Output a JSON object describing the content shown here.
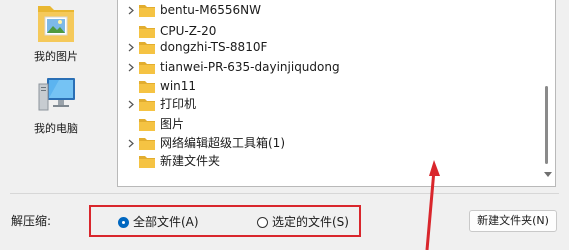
{
  "places": {
    "pictures_label": "我的图片",
    "pc_label": "我的电脑"
  },
  "tree": {
    "items": [
      {
        "name": "bentu-M6556NW",
        "expandable": true
      },
      {
        "name": "CPU-Z-20",
        "expandable": false
      },
      {
        "name": "dongzhi-TS-8810F",
        "expandable": true
      },
      {
        "name": "tianwei-PR-635-dayinjiqudong",
        "expandable": true
      },
      {
        "name": "win11",
        "expandable": false
      },
      {
        "name": "打印机",
        "expandable": true
      },
      {
        "name": "图片",
        "expandable": false
      },
      {
        "name": "网络编辑超级工具箱(1)",
        "expandable": true
      },
      {
        "name": "新建文件夹",
        "expandable": false
      }
    ]
  },
  "extract": {
    "label": "解压缩:",
    "option_all": "全部文件(A)",
    "option_selected": "选定的文件(S)",
    "selected": "all"
  },
  "buttons": {
    "new_folder": "新建文件夹(N)"
  },
  "colors": {
    "folder": "#f5c343",
    "highlight_box": "#d9262c",
    "radio_selected": "#0067c0"
  },
  "icons": {
    "folder": "folder-icon",
    "chevron": "chevron-right-icon",
    "pictures": "pictures-folder-icon",
    "computer": "computer-icon"
  }
}
